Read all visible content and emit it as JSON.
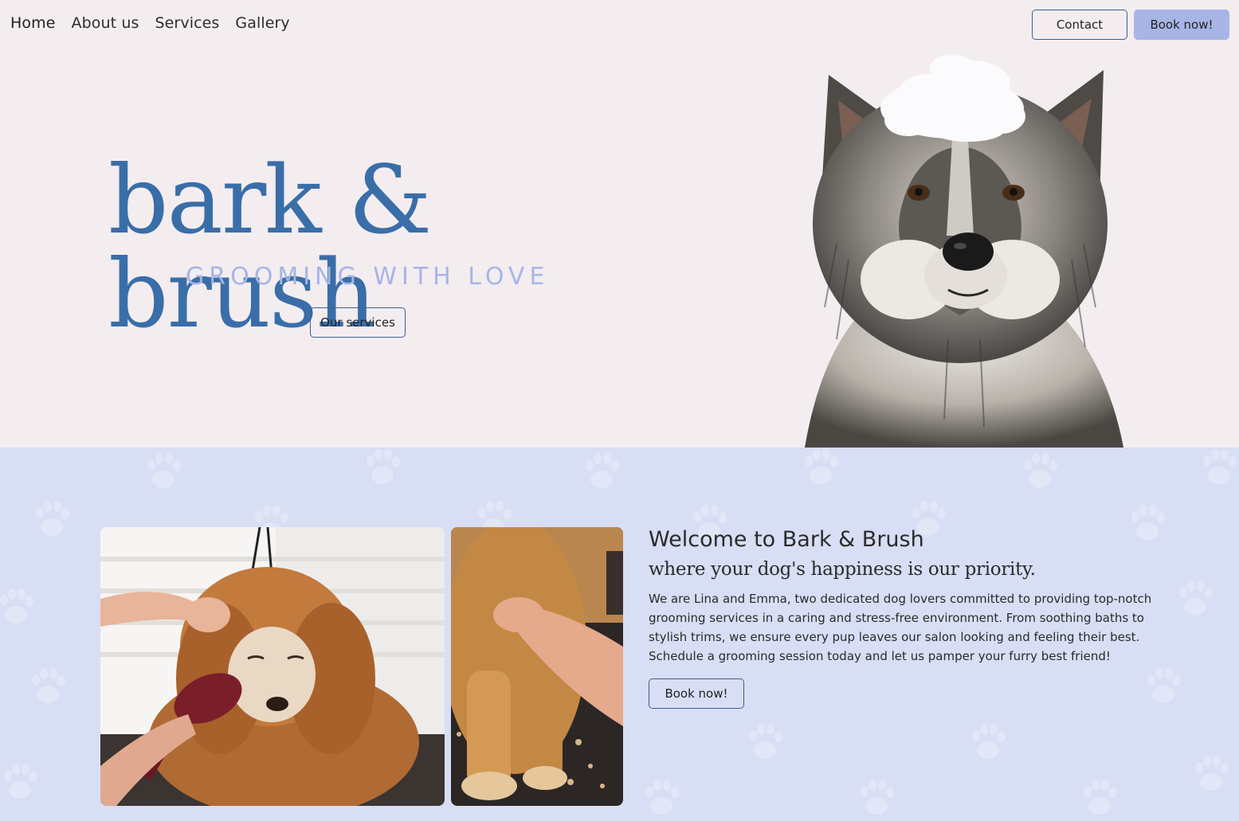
{
  "nav": {
    "items": [
      "Home",
      "About us",
      "Services",
      "Gallery"
    ]
  },
  "header": {
    "contact_label": "Contact",
    "book_label": "Book now!"
  },
  "hero": {
    "brand": "bark & brush",
    "tagline": "GROOMING WITH LOVE",
    "services_label": "Our services"
  },
  "welcome": {
    "title": "Welcome to Bark & Brush",
    "subtitle": "where your dog's happiness is our priority.",
    "body": "We are Lina and Emma, two dedicated dog lovers committed to providing top-notch grooming services in a caring and stress-free environment. From soothing baths to stylish trims, we ensure every pup leaves our salon looking and feeling their best. Schedule a grooming session today and let us pamper your furry best friend!",
    "book_label": "Book now!"
  },
  "colors": {
    "hero_bg": "#f3edf0",
    "section_bg": "#d8def4",
    "brand_blue": "#3a6ea8",
    "accent_lavender": "#a7b5e6",
    "button_border": "#3d5f8d"
  }
}
